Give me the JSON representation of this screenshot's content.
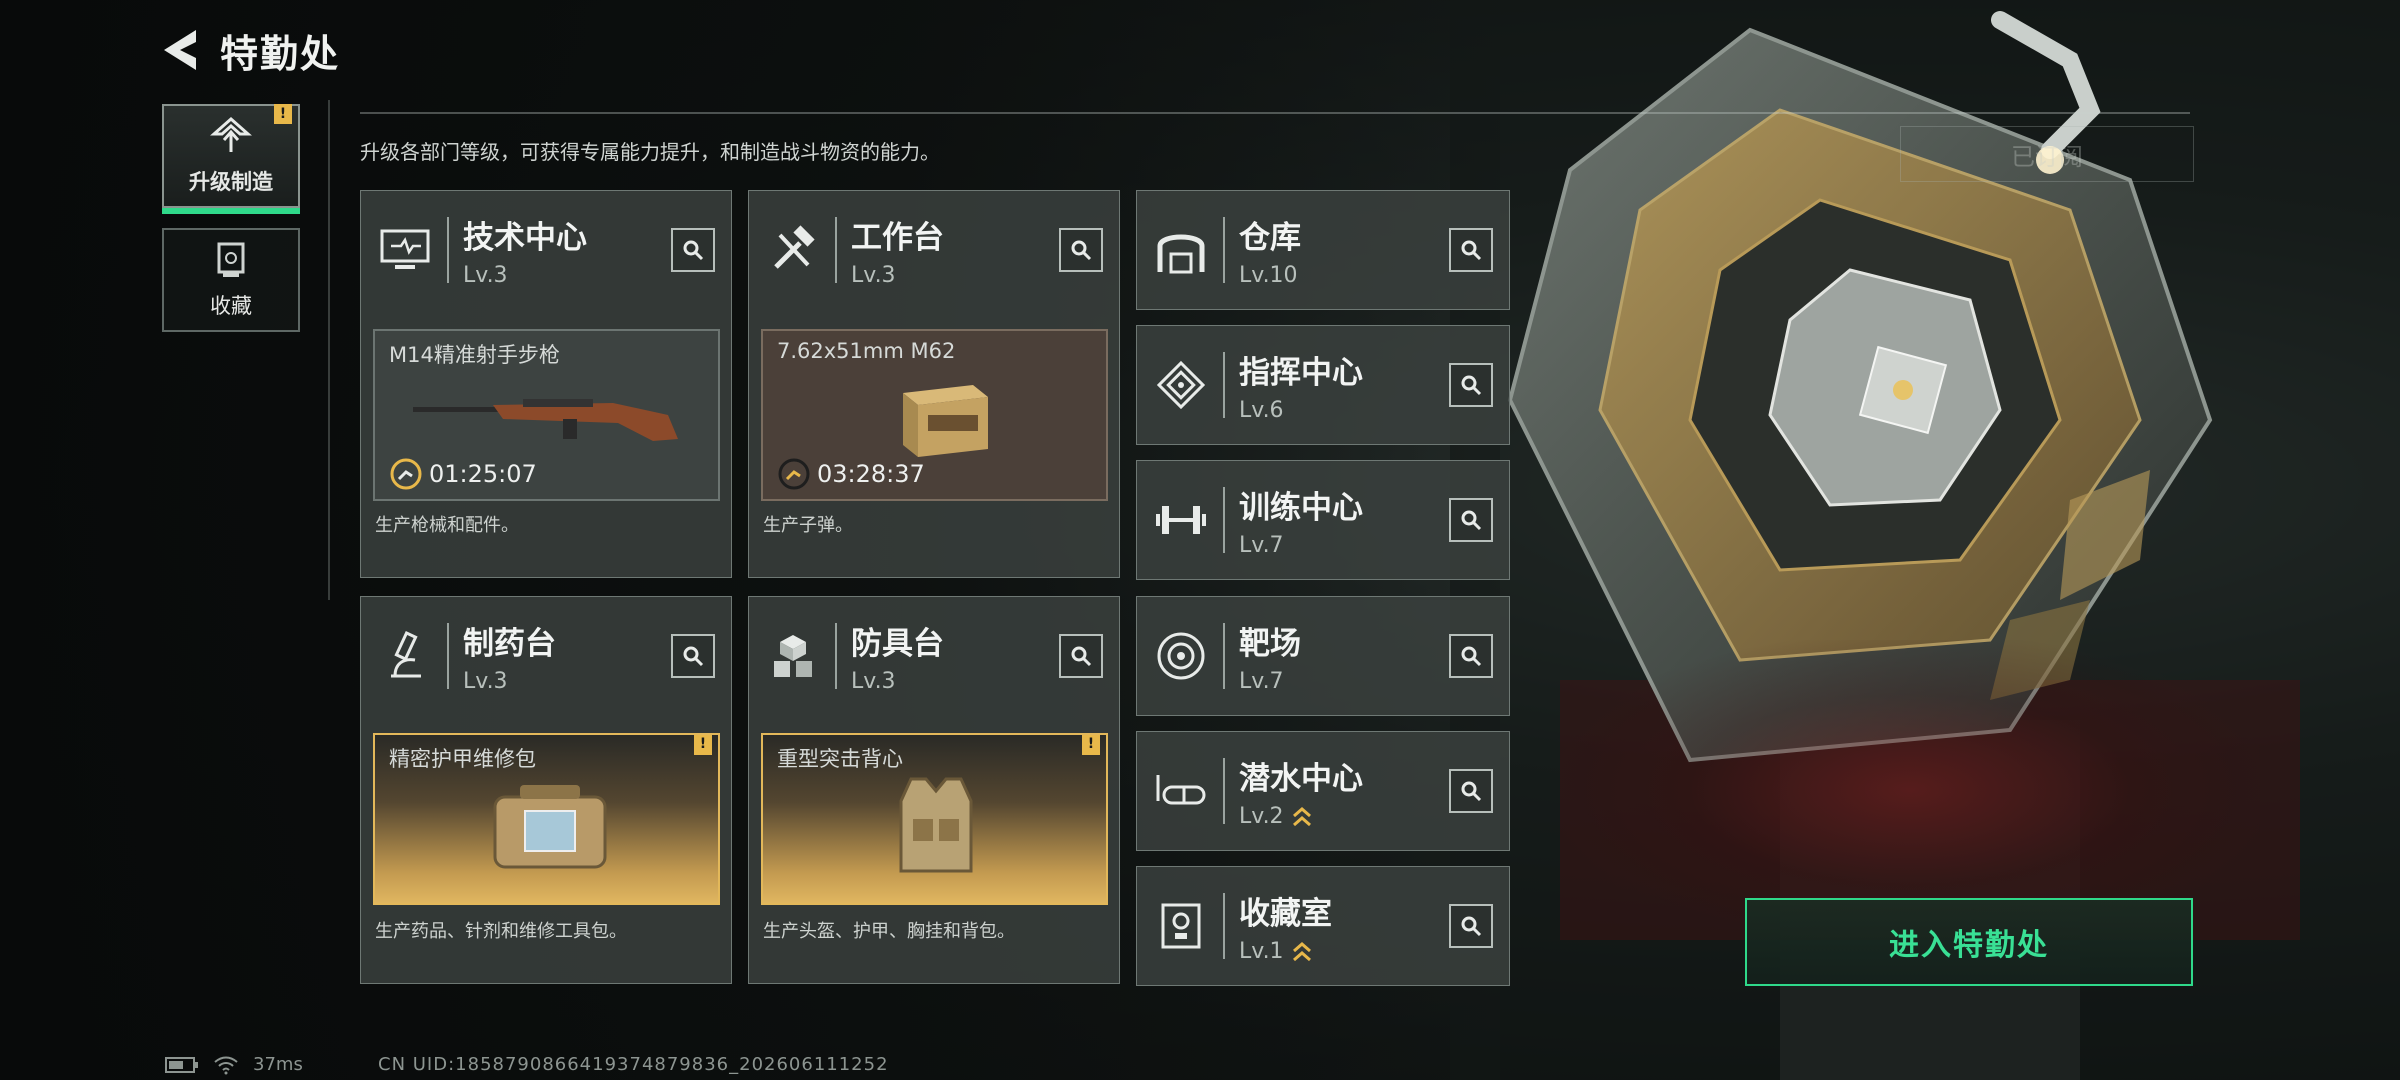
{
  "header": {
    "title": "特勤处"
  },
  "side_tabs": [
    {
      "label": "升级制造",
      "badge": "!"
    },
    {
      "label": "收藏"
    }
  ],
  "description": "升级各部门等级，可获得专属能力提升，和制造战斗物资的能力。",
  "big_cards": [
    {
      "name": "技术中心",
      "level": "Lv.3",
      "item": "M14精准射手步枪",
      "timer": "01:25:07",
      "desc": "生产枪械和配件。"
    },
    {
      "name": "工作台",
      "level": "Lv.3",
      "item": "7.62x51mm M62",
      "timer": "03:28:37",
      "desc": "生产子弹。"
    },
    {
      "name": "制药台",
      "level": "Lv.3",
      "item": "精密护甲维修包",
      "desc": "生产药品、针剂和维修工具包。",
      "badge": "!"
    },
    {
      "name": "防具台",
      "level": "Lv.3",
      "item": "重型突击背心",
      "desc": "生产头盔、护甲、胸挂和背包。",
      "badge": "!"
    }
  ],
  "small_cards": [
    {
      "name": "仓库",
      "level": "Lv.10"
    },
    {
      "name": "指挥中心",
      "level": "Lv.6"
    },
    {
      "name": "训练中心",
      "level": "Lv.7"
    },
    {
      "name": "靶场",
      "level": "Lv.7"
    },
    {
      "name": "潜水中心",
      "level": "Lv.2"
    },
    {
      "name": "收藏室",
      "level": "Lv.1"
    }
  ],
  "tray_button": "已订阅",
  "enter_button": "进入特勤处",
  "status": {
    "ping": "37ms",
    "uid": "CN UID:1858790866419374879836_202606111252"
  },
  "colors": {
    "accent_green": "#2fd98a",
    "warn_yellow": "#e8b84a",
    "panel": "#3c4240"
  }
}
